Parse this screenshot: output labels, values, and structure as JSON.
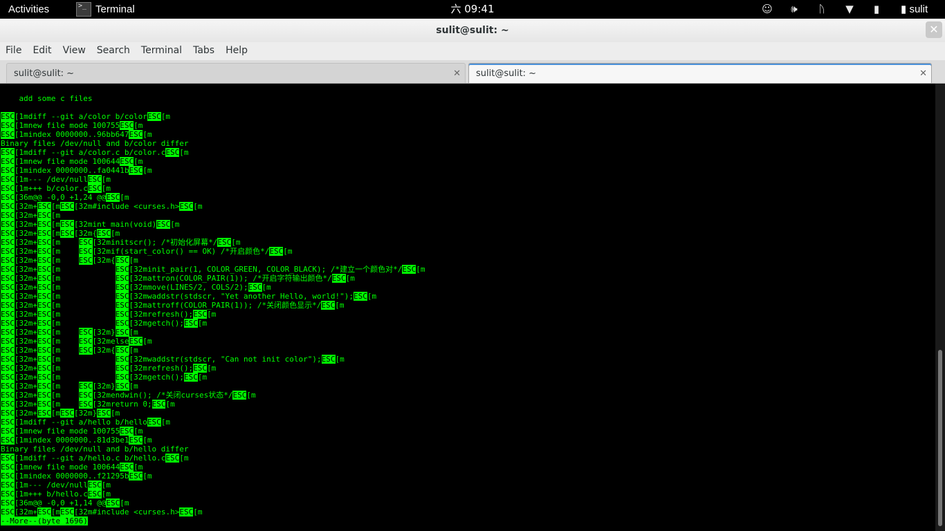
{
  "topbar": {
    "activities": "Activities",
    "app_icon_glyph": ">_",
    "app_name": "Terminal",
    "clock": "六 09:41",
    "icons": [
      "accessibility-icon",
      "volume-icon",
      "bluetooth-icon",
      "wifi-icon",
      "battery-icon"
    ],
    "user": "sulit"
  },
  "window": {
    "title": "sulit@sulit: ~",
    "close_glyph": "✕"
  },
  "menu": {
    "file": "File",
    "edit": "Edit",
    "view": "View",
    "search": "Search",
    "terminal": "Terminal",
    "tabs": "Tabs",
    "help": "Help"
  },
  "tabs": [
    {
      "label": "sulit@sulit: ~",
      "close": "✕",
      "active": false
    },
    {
      "label": "sulit@sulit: ~",
      "close": "✕",
      "active": true
    }
  ],
  "terminal": {
    "esc_marker": "ESC",
    "pager_status": "--More--(byte 1696)",
    "text_color": "#00ff00",
    "background_color": "#000000",
    "lines": [
      "    add some c files",
      "",
      "\u001b[1mdiff --git a/color b/color\u001b[m",
      "\u001b[1mnew file mode 100755\u001b[m",
      "\u001b[1mindex 0000000..96bb647\u001b[m",
      "Binary files /dev/null and b/color differ",
      "\u001b[1mdiff --git a/color.c b/color.c\u001b[m",
      "\u001b[1mnew file mode 100644\u001b[m",
      "\u001b[1mindex 0000000..fa0441b\u001b[m",
      "\u001b[1m--- /dev/null\u001b[m",
      "\u001b[1m+++ b/color.c\u001b[m",
      "\u001b[36m@@ -0,0 +1,24 @@\u001b[m",
      "\u001b[32m+\u001b[m\u001b[32m#include <curses.h>\u001b[m",
      "\u001b[32m+\u001b[m",
      "\u001b[32m+\u001b[m\u001b[32mint main(void)\u001b[m",
      "\u001b[32m+\u001b[m\u001b[32m{\u001b[m",
      "\u001b[32m+\u001b[m    \u001b[32minitscr(); /*初始化屏幕*/\u001b[m",
      "\u001b[32m+\u001b[m    \u001b[32mif(start_color() == OK) /*开启颜色*/\u001b[m",
      "\u001b[32m+\u001b[m    \u001b[32m{\u001b[m",
      "\u001b[32m+\u001b[m            \u001b[32minit_pair(1, COLOR_GREEN, COLOR_BLACK); /*建立一个颜色对*/\u001b[m",
      "\u001b[32m+\u001b[m            \u001b[32mattron(COLOR_PAIR(1)); /*开启字符输出颜色*/\u001b[m",
      "\u001b[32m+\u001b[m            \u001b[32mmove(LINES/2, COLS/2);\u001b[m",
      "\u001b[32m+\u001b[m            \u001b[32mwaddstr(stdscr, \"Yet another Hello, world!\");\u001b[m",
      "\u001b[32m+\u001b[m            \u001b[32mattroff(COLOR_PAIR(1)); /*关闭颜色显示*/\u001b[m",
      "\u001b[32m+\u001b[m            \u001b[32mrefresh();\u001b[m",
      "\u001b[32m+\u001b[m            \u001b[32mgetch();\u001b[m",
      "\u001b[32m+\u001b[m    \u001b[32m}\u001b[m",
      "\u001b[32m+\u001b[m    \u001b[32melse\u001b[m",
      "\u001b[32m+\u001b[m    \u001b[32m{\u001b[m",
      "\u001b[32m+\u001b[m            \u001b[32mwaddstr(stdscr, \"Can not init color\");\u001b[m",
      "\u001b[32m+\u001b[m            \u001b[32mrefresh();\u001b[m",
      "\u001b[32m+\u001b[m            \u001b[32mgetch();\u001b[m",
      "\u001b[32m+\u001b[m    \u001b[32m}\u001b[m",
      "\u001b[32m+\u001b[m    \u001b[32mendwin(); /*关闭curses状态*/\u001b[m",
      "\u001b[32m+\u001b[m    \u001b[32mreturn 0;\u001b[m",
      "\u001b[32m+\u001b[m\u001b[32m}\u001b[m",
      "\u001b[1mdiff --git a/hello b/hello\u001b[m",
      "\u001b[1mnew file mode 100755\u001b[m",
      "\u001b[1mindex 0000000..81d3be1\u001b[m",
      "Binary files /dev/null and b/hello differ",
      "\u001b[1mdiff --git a/hello.c b/hello.c\u001b[m",
      "\u001b[1mnew file mode 100644\u001b[m",
      "\u001b[1mindex 0000000..f21295b\u001b[m",
      "\u001b[1m--- /dev/null\u001b[m",
      "\u001b[1m+++ b/hello.c\u001b[m",
      "\u001b[36m@@ -0,0 +1,14 @@\u001b[m",
      "\u001b[32m+\u001b[m\u001b[32m#include <curses.h>\u001b[m"
    ]
  }
}
